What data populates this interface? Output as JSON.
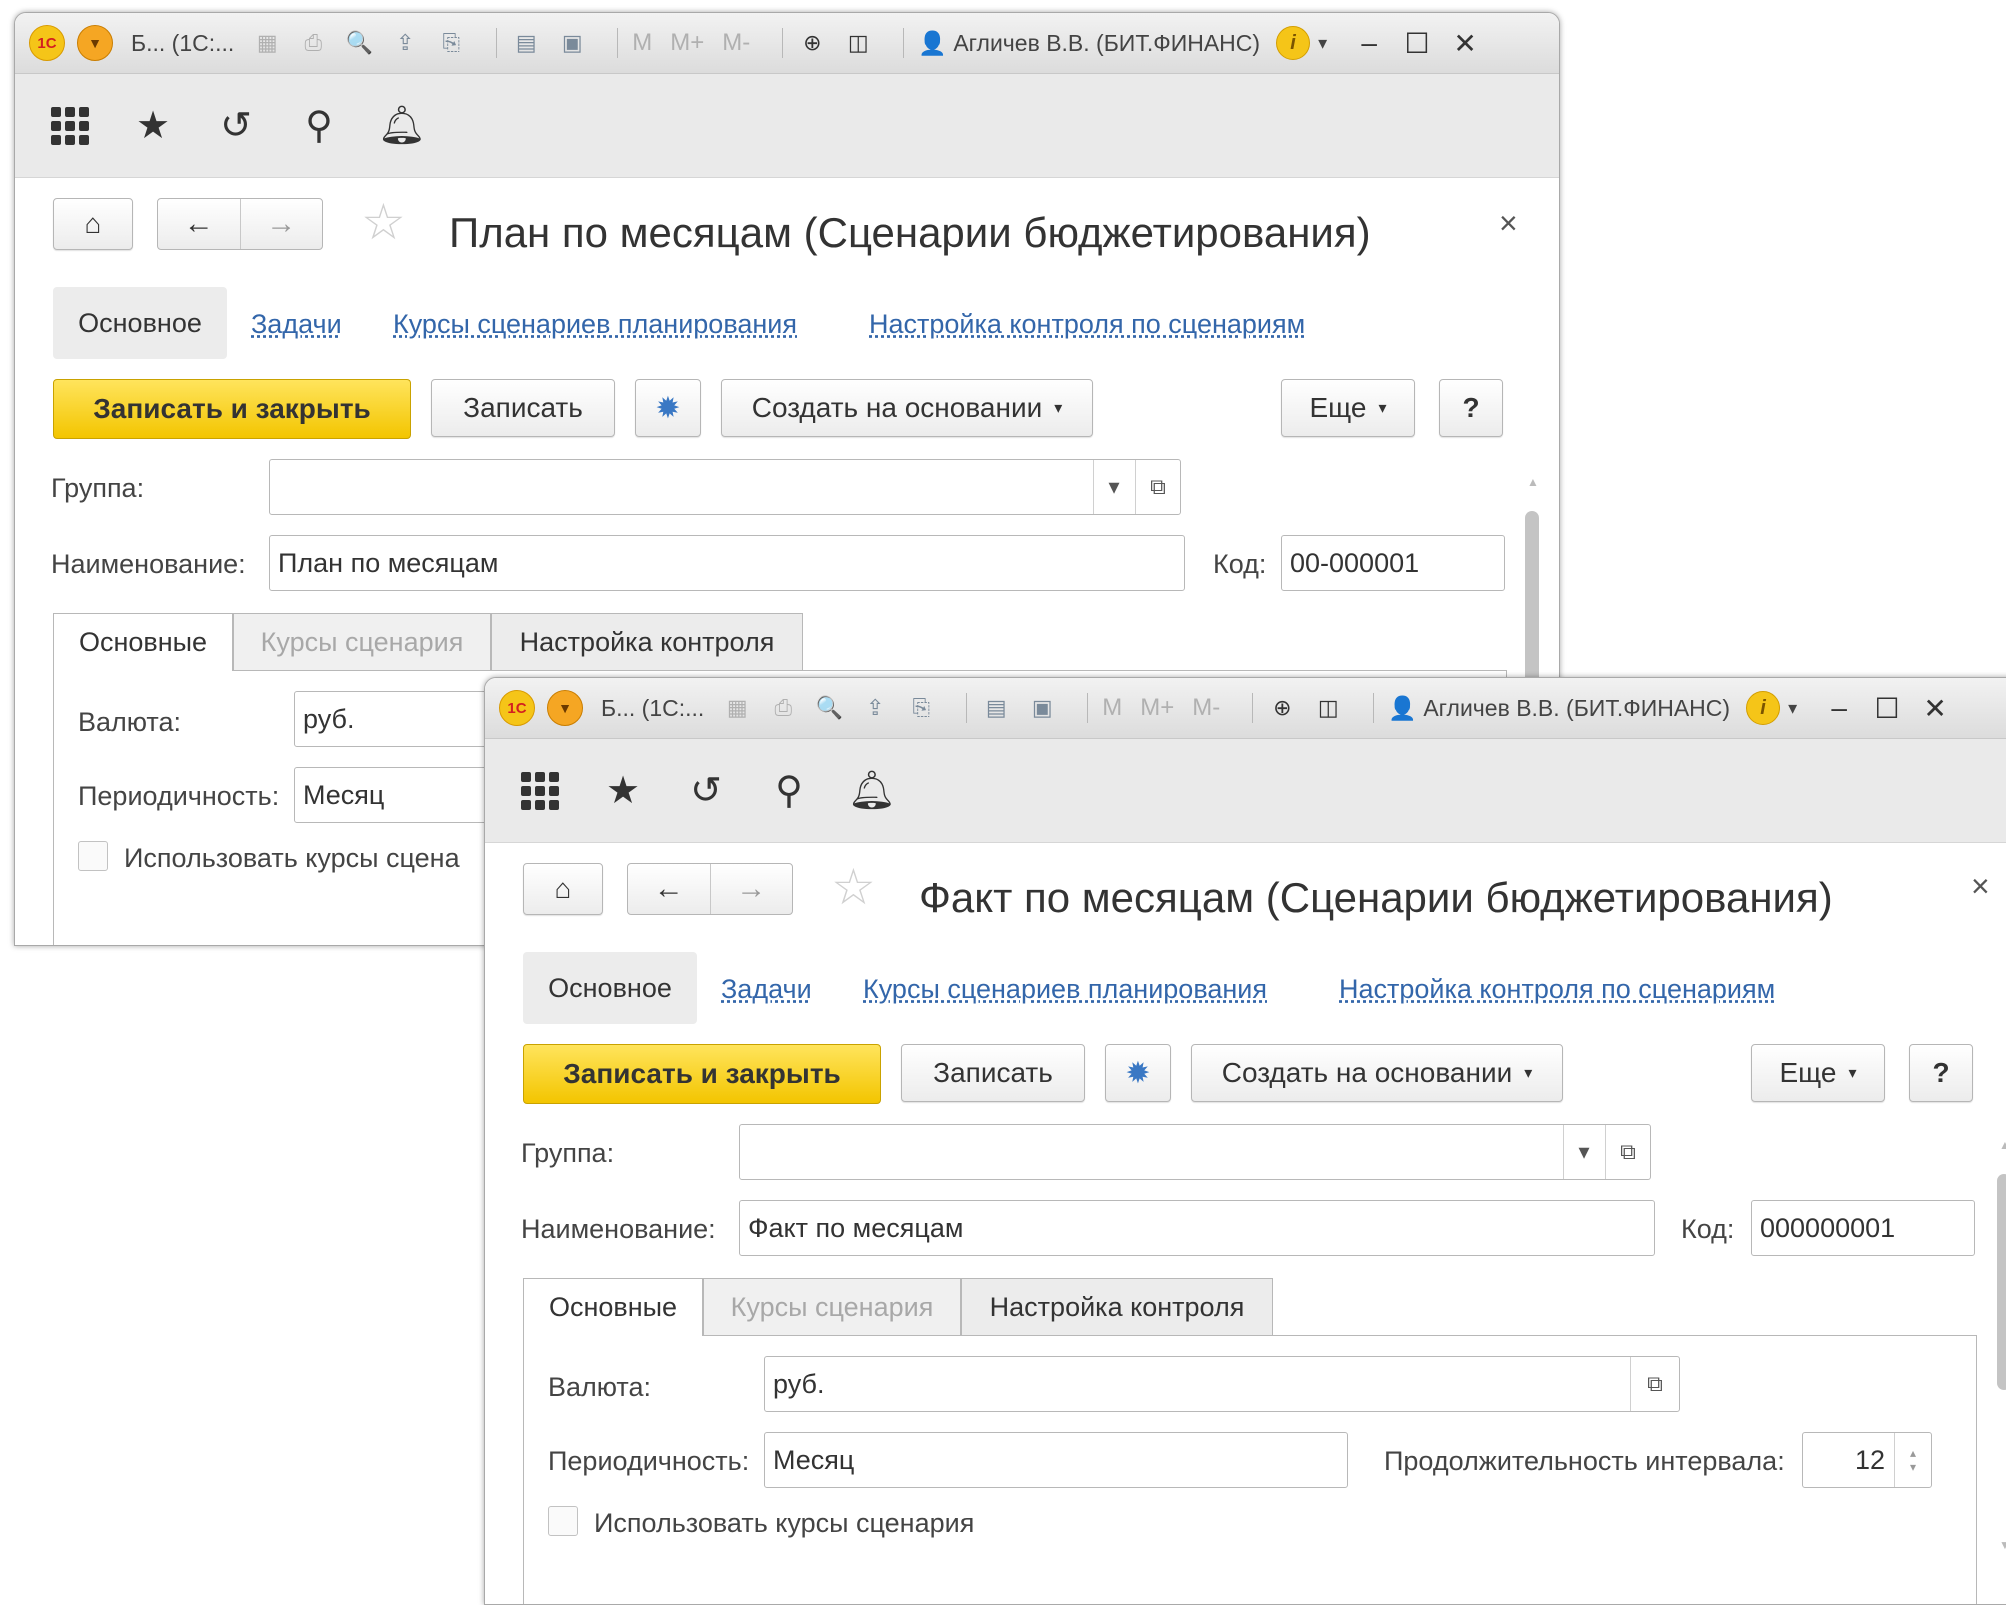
{
  "titlebar": {
    "app_text": "Б... (1С:...",
    "m_labels": [
      "M",
      "M+",
      "M-"
    ],
    "user": "Агличев В.В. (БИТ.ФИНАНС)"
  },
  "window1": {
    "title": "План по месяцам (Сценарии бюджетирования)",
    "sections": [
      "Основное",
      "Задачи",
      "Курсы сценариев планирования",
      "Настройка контроля по сценариям"
    ],
    "buttons": {
      "save_close": "Записать и закрыть",
      "save": "Записать",
      "create_based": "Создать на основании",
      "more": "Еще",
      "help": "?"
    },
    "fields": {
      "group_label": "Группа:",
      "group_value": "",
      "name_label": "Наименование:",
      "name_value": "План по месяцам",
      "code_label": "Код:",
      "code_value": "00-000001"
    },
    "tabs": [
      "Основные",
      "Курсы сценария",
      "Настройка контроля"
    ],
    "panel": {
      "currency_label": "Валюта:",
      "currency_value": "руб.",
      "period_label": "Периодичность:",
      "period_value": "Месяц",
      "checkbox_label": "Использовать курсы сцена"
    }
  },
  "window2": {
    "title": "Факт по месяцам (Сценарии бюджетирования)",
    "sections": [
      "Основное",
      "Задачи",
      "Курсы сценариев планирования",
      "Настройка контроля по сценариям"
    ],
    "buttons": {
      "save_close": "Записать и закрыть",
      "save": "Записать",
      "create_based": "Создать на основании",
      "more": "Еще",
      "help": "?"
    },
    "fields": {
      "group_label": "Группа:",
      "group_value": "",
      "name_label": "Наименование:",
      "name_value": "Факт по месяцам",
      "code_label": "Код:",
      "code_value": "000000001"
    },
    "tabs": [
      "Основные",
      "Курсы сценария",
      "Настройка контроля"
    ],
    "panel": {
      "currency_label": "Валюта:",
      "currency_value": "руб.",
      "period_label": "Периодичность:",
      "period_value": "Месяц",
      "interval_label": "Продолжительность интервала:",
      "interval_value": "12",
      "checkbox_label": "Использовать курсы сценария"
    }
  },
  "colors": {
    "accent_yellow": "#f5d020",
    "link_blue": "#3366aa"
  }
}
